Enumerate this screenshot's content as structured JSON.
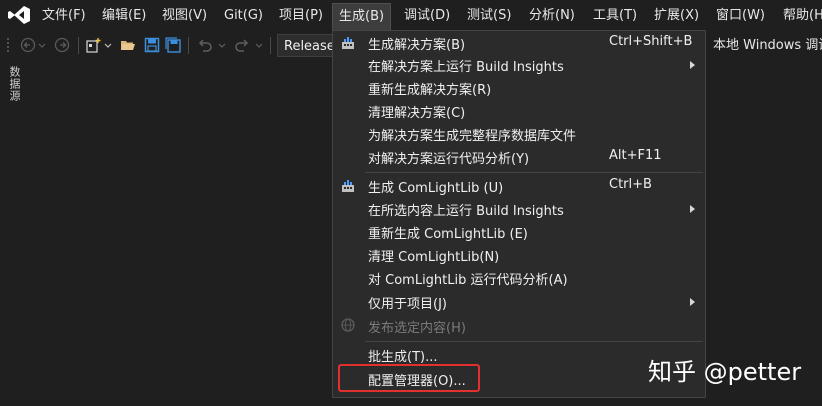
{
  "menubar": {
    "items": [
      {
        "label": "文件(F)"
      },
      {
        "label": "编辑(E)"
      },
      {
        "label": "视图(V)"
      },
      {
        "label": "Git(G)"
      },
      {
        "label": "项目(P)"
      },
      {
        "label": "生成(B)",
        "active": true
      },
      {
        "label": "调试(D)"
      },
      {
        "label": "测试(S)"
      },
      {
        "label": "分析(N)"
      },
      {
        "label": "工具(T)"
      },
      {
        "label": "扩展(X)"
      },
      {
        "label": "窗口(W)"
      },
      {
        "label": "帮助(H"
      }
    ]
  },
  "toolbar": {
    "configuration": "Release",
    "target": "本地 Windows 调试"
  },
  "side_tab": {
    "label": "数据源"
  },
  "build_menu": {
    "items": [
      {
        "label": "生成解决方案(B)",
        "shortcut": "Ctrl+Shift+B",
        "icon": "build-icon"
      },
      {
        "label": "在解决方案上运行 Build Insights",
        "submenu": true
      },
      {
        "label": "重新生成解决方案(R)"
      },
      {
        "label": "清理解决方案(C)"
      },
      {
        "label": "为解决方案生成完整程序数据库文件"
      },
      {
        "label": "对解决方案运行代码分析(Y)",
        "shortcut": "Alt+F11"
      },
      {
        "label": "生成 ComLightLib (U)",
        "shortcut": "Ctrl+B",
        "icon": "build-project-icon"
      },
      {
        "label": "在所选内容上运行 Build Insights",
        "submenu": true
      },
      {
        "label": "重新生成 ComLightLib (E)"
      },
      {
        "label": "清理 ComLightLib(N)"
      },
      {
        "label": "对 ComLightLib 运行代码分析(A)"
      },
      {
        "label": "仅用于项目(J)",
        "submenu": true
      },
      {
        "label": "发布选定内容(H)",
        "disabled": true,
        "icon": "globe-icon"
      },
      {
        "label": "批生成(T)..."
      },
      {
        "label": "配置管理器(O)..."
      }
    ]
  },
  "watermark": {
    "text": "知乎 @petter"
  },
  "colors": {
    "highlight_border": "#e03030",
    "menu_bg": "#2b2b2b"
  }
}
